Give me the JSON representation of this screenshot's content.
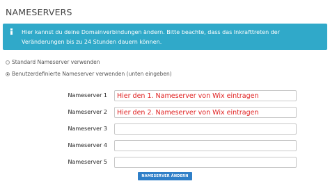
{
  "page": {
    "title": "NAMESERVERS"
  },
  "info": {
    "text": "Hier kannst du deine Domainverbindungen ändern. Bitte beachte, dass das Inkrafttreten der Veränderungen bis zu 24 Stunden dauern können."
  },
  "options": [
    {
      "label": "Standard Nameserver verwenden",
      "checked": false
    },
    {
      "label": "Benutzerdefinierte Nameserver verwenden (unten eingeben)",
      "checked": true
    }
  ],
  "nameservers": [
    {
      "label": "Nameserver 1",
      "value": "Hier den 1. Nameserver von Wix eintragen"
    },
    {
      "label": "Nameserver 2",
      "value": "Hier den 2. Nameserver von Wix eintragen"
    },
    {
      "label": "Nameserver 3",
      "value": ""
    },
    {
      "label": "Nameserver 4",
      "value": ""
    },
    {
      "label": "Nameserver 5",
      "value": ""
    }
  ],
  "submit": {
    "label": "NAMESERVER ÄNDERN"
  },
  "colors": {
    "info_background": "#30a9c9",
    "button_background": "#2f7fc8",
    "annotation_text": "#e02020"
  }
}
